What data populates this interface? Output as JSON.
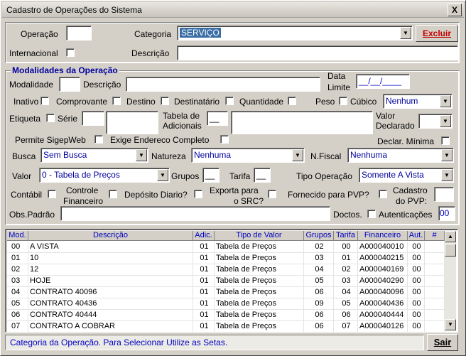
{
  "window": {
    "title": "Cadastro de Operações do Sistema",
    "close": "X"
  },
  "header": {
    "operacao_label": "Operação",
    "operacao_value": "",
    "categoria_label": "Categoria",
    "categoria_value": "SERVIÇO",
    "excluir_label": "Excluir",
    "internacional_label": "Internacional",
    "descricao_label": "Descrição",
    "descricao_value": ""
  },
  "modalidades": {
    "title": "Modalidades da Operação",
    "modalidade_label": "Modalidade",
    "descricao_label": "Descrição",
    "data_limite_label_1": "Data",
    "data_limite_label_2": "Limite",
    "data_limite_value": "__/__/____"
  },
  "flags": {
    "inativo": "Inativo",
    "comprovante": "Comprovante",
    "destino": "Destino",
    "destinatario": "Destinatário",
    "quantidade": "Quantidade",
    "peso": "Peso",
    "cubico": "Cúbico",
    "cubico_value": "Nenhum",
    "etiqueta": "Etiqueta",
    "serie": "Série",
    "tabela_adicionais_1": "Tabela de",
    "tabela_adicionais_2": "Adicionais",
    "tabela_value": "__",
    "valor_declarado_1": "Valor",
    "valor_declarado_2": "Declarado",
    "permite_sigepweb": "Permite SigepWeb",
    "exige_endereco": "Exige Endereco Completo",
    "declar_minima": "Declar. Mínima",
    "busca_label": "Busca",
    "busca_value": "Sem Busca",
    "natureza_label": "Natureza",
    "natureza_value": "Nenhuma",
    "nfiscal_label": "N.Fiscal",
    "nfiscal_value": "Nenhuma",
    "valor_label": "Valor",
    "valor_value": "0 - Tabela de Preços",
    "grupos_label": "Grupos",
    "grupos_value": "__",
    "tarifa_label": "Tarifa",
    "tarifa_value": "__",
    "tipo_operacao_label": "Tipo Operação",
    "tipo_operacao_value": "Somente A Vista",
    "contabil": "Contábil",
    "controle_financeiro_1": "Controle",
    "controle_financeiro_2": "Financeiro",
    "deposito_diario": "Depósito Diario?",
    "exporta_src_1": "Exporta para",
    "exporta_src_2": "o SRC?",
    "fornecido_pvp": "Fornecido para PVP?",
    "cadastro_pvp_1": "Cadastro",
    "cadastro_pvp_2": "do PVP:",
    "obs_padrao_label": "Obs.Padrão",
    "doctos_label": "Doctos.",
    "autenticacoes_label": "Autenticações",
    "autenticacoes_value": "00"
  },
  "table": {
    "headers": [
      "Mod.",
      "Descrição",
      "Adic.",
      "Tipo de Valor",
      "Grupos",
      "Tarifa",
      "Financeiro",
      "Aut.",
      "#"
    ],
    "rows": [
      [
        "00",
        "A VISTA",
        "01",
        "Tabela de Preços",
        "02",
        "00",
        "A000040010",
        "00",
        ""
      ],
      [
        "01",
        "10",
        "01",
        "Tabela de Preços",
        "03",
        "01",
        "A000040215",
        "00",
        ""
      ],
      [
        "02",
        "12",
        "01",
        "Tabela de Preços",
        "04",
        "02",
        "A000040169",
        "00",
        ""
      ],
      [
        "03",
        "HOJE",
        "01",
        "Tabela de Preços",
        "05",
        "03",
        "A000040290",
        "00",
        ""
      ],
      [
        "04",
        "CONTRATO 40096",
        "01",
        "Tabela de Preços",
        "06",
        "04",
        "A000040096",
        "00",
        ""
      ],
      [
        "05",
        "CONTRATO 40436",
        "01",
        "Tabela de Preços",
        "09",
        "05",
        "A000040436",
        "00",
        ""
      ],
      [
        "06",
        "CONTRATO 40444",
        "01",
        "Tabela de Preços",
        "06",
        "06",
        "A000040444",
        "00",
        ""
      ],
      [
        "07",
        "CONTRATO A COBRAR",
        "01",
        "Tabela de Preços",
        "06",
        "07",
        "A000040126",
        "00",
        ""
      ]
    ]
  },
  "status": {
    "text": "Categoria da Operação. Para Selecionar Utilize as Setas."
  },
  "sair_label": "Sair"
}
